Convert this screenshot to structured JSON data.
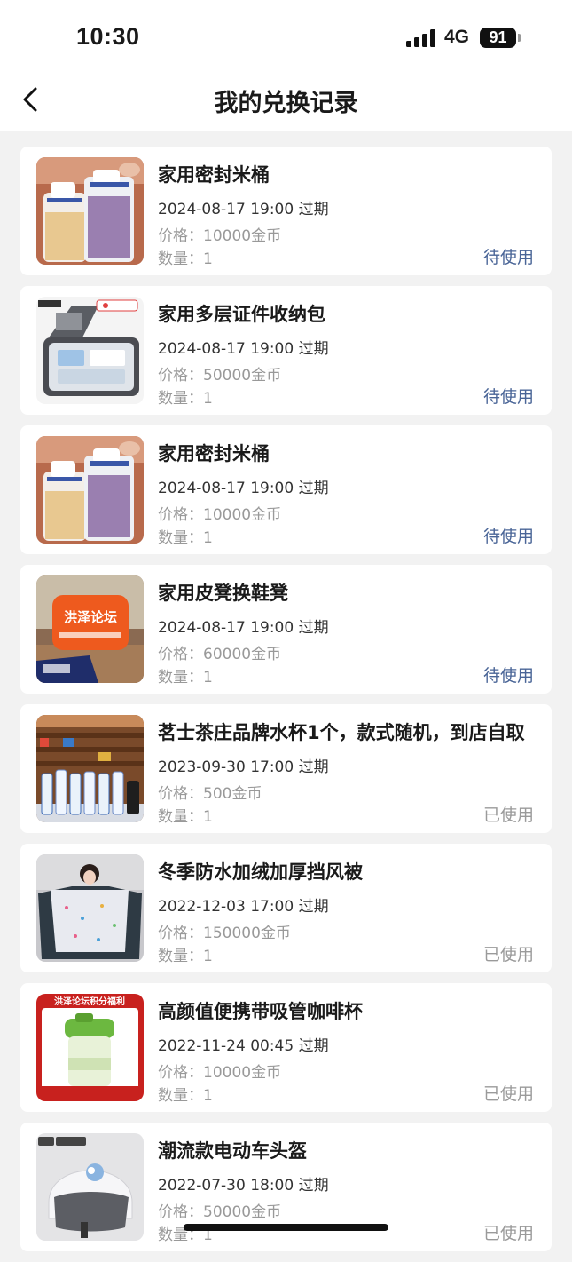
{
  "status_bar": {
    "time": "10:30",
    "network": "4G",
    "battery": "91"
  },
  "header": {
    "title": "我的兑换记录"
  },
  "records": [
    {
      "name": "家用密封米桶",
      "expire": "2024-08-17 19:00 过期",
      "price": "价格：10000金币",
      "qty": "数量：1",
      "status": "待使用",
      "status_type": "pending",
      "image": "rice-bucket-image"
    },
    {
      "name": "家用多层证件收纳包",
      "expire": "2024-08-17 19:00 过期",
      "price": "价格：50000金币",
      "qty": "数量：1",
      "status": "待使用",
      "status_type": "pending",
      "image": "document-organizer-image"
    },
    {
      "name": "家用密封米桶",
      "expire": "2024-08-17 19:00 过期",
      "price": "价格：10000金币",
      "qty": "数量：1",
      "status": "待使用",
      "status_type": "pending",
      "image": "rice-bucket-image"
    },
    {
      "name": "家用皮凳换鞋凳",
      "expire": "2024-08-17 19:00 过期",
      "price": "价格：60000金币",
      "qty": "数量：1",
      "status": "待使用",
      "status_type": "pending",
      "image": "stool-image",
      "image_text": "洪泽论坛"
    },
    {
      "name": "茗士茶庄品牌水杯1个，款式随机，到店自取",
      "expire": "2023-09-30 17:00 过期",
      "price": "价格：500金币",
      "qty": "数量：1",
      "status": "已使用",
      "status_type": "used",
      "image": "tea-shop-cups-image"
    },
    {
      "name": "冬季防水加绒加厚挡风被",
      "expire": "2022-12-03 17:00 过期",
      "price": "价格：150000金币",
      "qty": "数量：1",
      "status": "已使用",
      "status_type": "used",
      "image": "windshield-quilt-image"
    },
    {
      "name": "高颜值便携带吸管咖啡杯",
      "expire": "2022-11-24 00:45 过期",
      "price": "价格：10000金币",
      "qty": "数量：1",
      "status": "已使用",
      "status_type": "used",
      "image": "coffee-cup-image",
      "image_text": "洪泽论坛积分福利"
    },
    {
      "name": "潮流款电动车头盔",
      "expire": "2022-07-30 18:00 过期",
      "price": "价格：50000金币",
      "qty": "数量：1",
      "status": "已使用",
      "status_type": "used",
      "image": "helmet-image"
    }
  ],
  "colors": {
    "pending": "#4a6597",
    "used": "#9a9a9a",
    "background": "#f2f2f2"
  }
}
